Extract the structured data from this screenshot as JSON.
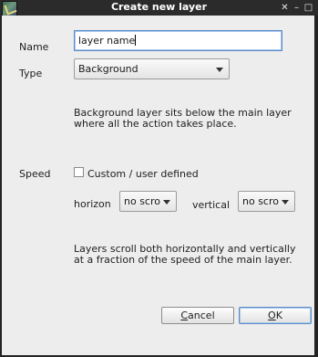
{
  "window": {
    "title": "Create new layer",
    "buttons": {
      "close": "✕",
      "minimize": "–",
      "maximize": "□"
    }
  },
  "form": {
    "name_label": "Name",
    "name_value": "layer name",
    "type_label": "Type",
    "type_value": "Background",
    "type_description_line1": "Background layer sits below the main layer",
    "type_description_line2": "where all the action takes place.",
    "speed_label": "Speed",
    "custom_checkbox_label": "Custom / user defined",
    "custom_checked": false,
    "horizon_label": "horizon",
    "horizon_value": "no scro",
    "vertical_label": "vertical",
    "vertical_value": "no scro",
    "speed_description_line1": "Layers scroll both horizontally and vertically",
    "speed_description_line2": "at a fraction of the speed of the main layer."
  },
  "actions": {
    "cancel_first": "C",
    "cancel_rest": "ancel",
    "ok_first": "O",
    "ok_rest": "K"
  },
  "colors": {
    "titlebar": "#2b2b2b",
    "dialog_bg": "#ededed",
    "focus_border": "#5b8cc7"
  },
  "icons": {
    "app": "app-icon",
    "close": "close-icon",
    "minimize": "minimize-icon",
    "maximize": "maximize-icon",
    "dropdown": "chevron-down-icon"
  }
}
